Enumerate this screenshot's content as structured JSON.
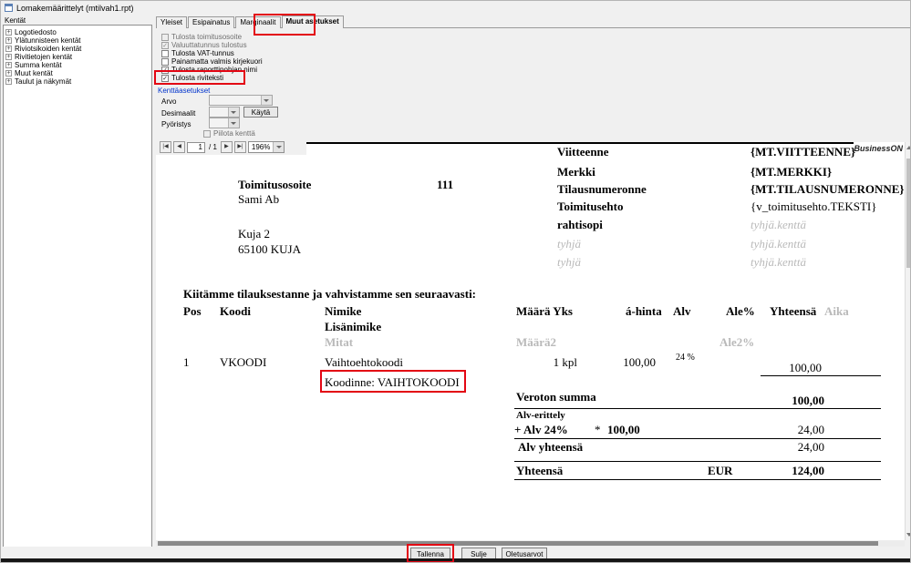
{
  "window": {
    "title": "Lomakemäärittelyt (mtilvah1.rpt)"
  },
  "left_panel": {
    "header": "Kentät",
    "items": [
      {
        "label": "Logotiedosto"
      },
      {
        "label": "Ylätunnisteen kentät"
      },
      {
        "label": "Riviotsikoiden kentät"
      },
      {
        "label": "Rivitietojen kentät"
      },
      {
        "label": "Summa kentät"
      },
      {
        "label": "Muut kentät"
      },
      {
        "label": "Taulut ja näkymät"
      }
    ]
  },
  "tabs": {
    "items": [
      {
        "label": "Yleiset"
      },
      {
        "label": "Esipainatus"
      },
      {
        "label": "Marginaalit"
      },
      {
        "label": "Muut asetukset"
      }
    ]
  },
  "options": {
    "items": [
      {
        "label": "Tulosta toimitusosoite",
        "mark": ""
      },
      {
        "label": "Valuuttatunnus tulostus",
        "mark": "✓"
      },
      {
        "label": "Tulosta VAT-tunnus",
        "mark": ""
      },
      {
        "label": "Painamatta valmis kirjekuori",
        "mark": ""
      },
      {
        "label": "Tulosta raporttipohjan nimi",
        "mark": "✓"
      },
      {
        "label": "Tulosta riviteksti",
        "mark": "✓"
      }
    ]
  },
  "field_settings": {
    "header": "Kenttäasetukset",
    "arvo_label": "Arvo",
    "desimaalit_label": "Desimaalit",
    "kayta_button": "Käytä",
    "pyoristys_label": "Pyöristys",
    "piilota_label": "Piilota kenttä"
  },
  "toolbar": {
    "page_current": "1",
    "page_total": "/ 1",
    "zoom": "196%",
    "icons": {
      "first": "|◀",
      "prev": "◀",
      "next": "▶",
      "last": "▶|"
    }
  },
  "document": {
    "brand": "BusinessON",
    "right_fields": [
      {
        "label": "Viitteenne",
        "value": "{MT.VIITTEENNE}"
      },
      {
        "label": "Merkki",
        "value": "{MT.MERKKI}"
      },
      {
        "label": "Tilausnumeronne",
        "value": "{MT.TILAUSNUMERONNE}"
      },
      {
        "label": "Toimitusehto",
        "value": "{v_toimitusehto.TEKSTI}"
      },
      {
        "label": "rahtisopi",
        "value": "tyhjä.kenttä"
      },
      {
        "label": "tyhjä",
        "value": "tyhjä.kenttä"
      },
      {
        "label": "tyhjä",
        "value": "tyhjä.kenttä"
      }
    ],
    "delivery": {
      "label": "Toimitusosoite",
      "number": "111",
      "name": "Sami Ab",
      "street": "Kuja 2",
      "city": "65100 KUJA"
    },
    "intro": "Kiitämme tilauksestanne ja vahvistamme sen seuraavasti:",
    "table": {
      "headers": {
        "pos": "Pos",
        "koodi": "Koodi",
        "nimike": "Nimike",
        "lisanimike": "Lisänimike",
        "mitat": "Mitat",
        "maara": "Määrä Yks",
        "maara2": "Määrä2",
        "ahinta": "á-hinta",
        "alv": "Alv",
        "ale": "Ale%",
        "ale2": "Ale2%",
        "yhteensa": "Yhteensä",
        "aika": "Aika"
      },
      "row": {
        "pos": "1",
        "koodi": "VKOODI",
        "nimike": "Vaihtoehtokoodi",
        "maara": "1 kpl",
        "ahinta": "100,00",
        "alv": "24 %",
        "yhteensa": "100,00",
        "koodinne": "Koodinne: VAIHTOKOODI"
      }
    },
    "summary": {
      "veroton_label": "Veroton summa",
      "veroton_value": "100,00",
      "alverittely_label": "Alv-erittely",
      "alv_row_label": "+ Alv 24%",
      "alv_row_mult": "*",
      "alv_row_base": "100,00",
      "alv_row_value": "24,00",
      "alv_yht_label": "Alv yhteensä",
      "alv_yht_value": "24,00",
      "total_label": "Yhteensä",
      "currency": "EUR",
      "total_value": "124,00"
    }
  },
  "bottom": {
    "buttons": [
      {
        "label": "Tallenna"
      },
      {
        "label": "Sulje"
      },
      {
        "label": "Oletusarvot"
      }
    ]
  }
}
